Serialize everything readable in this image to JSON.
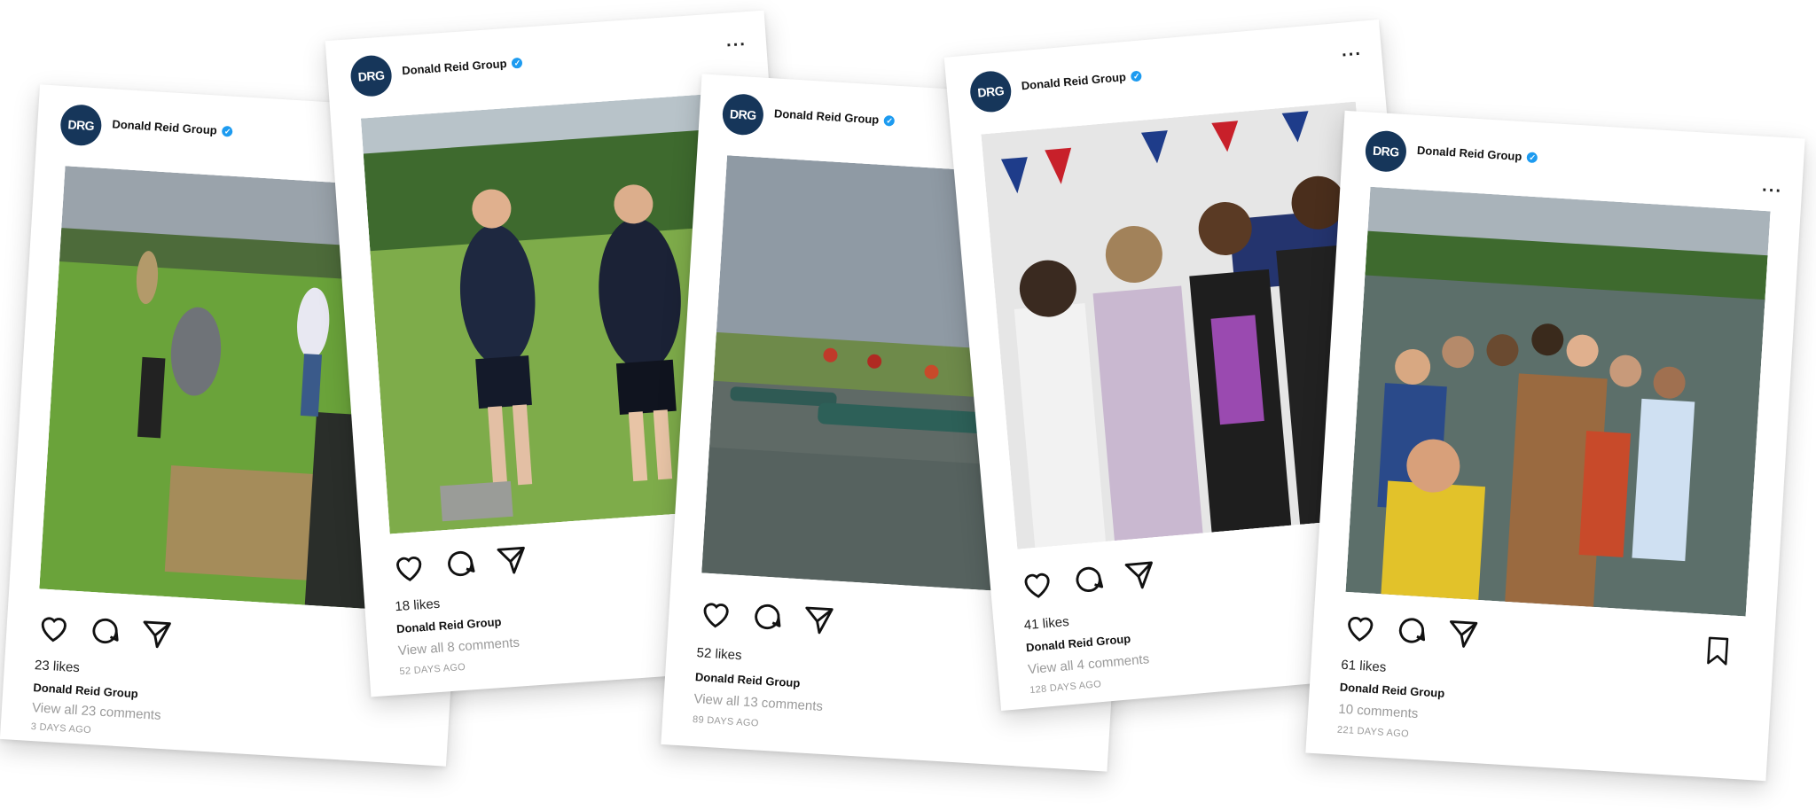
{
  "brand_color": "#16365a",
  "posts": [
    {
      "avatar_text": "DRG",
      "account": "Donald Reid Group",
      "verified": "✓",
      "more": "",
      "likes": "23 likes",
      "username": "Donald Reid Group",
      "comments": "View all 23 comments",
      "age": "3 DAYS AGO",
      "bookmark": false,
      "photo": "people working in a grassy field with hay bales"
    },
    {
      "avatar_text": "DRG",
      "account": "Donald Reid Group",
      "verified": "✓",
      "more": "···",
      "likes": "18 likes",
      "username": "Donald Reid Group",
      "comments": "View all 8 comments",
      "age": "52 DAYS AGO",
      "bookmark": false,
      "photo": "two men in sportswear standing on grass"
    },
    {
      "avatar_text": "DRG",
      "account": "Donald Reid Group",
      "verified": "✓",
      "more": "",
      "likes": "52 likes",
      "username": "Donald Reid Group",
      "comments": "View all 13 comments",
      "age": "89 DAYS AGO",
      "bookmark": false,
      "photo": "group with canoes on a riverbank"
    },
    {
      "avatar_text": "DRG",
      "account": "Donald Reid Group",
      "verified": "✓",
      "more": "···",
      "likes": "41 likes",
      "username": "Donald Reid Group",
      "comments": "View all 4 comments",
      "age": "128 DAYS AGO",
      "bookmark": false,
      "photo": "four women holding wooden spoons under bunting"
    },
    {
      "avatar_text": "DRG",
      "account": "Donald Reid Group",
      "verified": "✓",
      "more": "···",
      "likes": "61 likes",
      "username": "Donald Reid Group",
      "comments": "10 comments",
      "age": "221 DAYS AGO",
      "bookmark": true,
      "photo": "large group selfie on a boat on the river"
    }
  ]
}
